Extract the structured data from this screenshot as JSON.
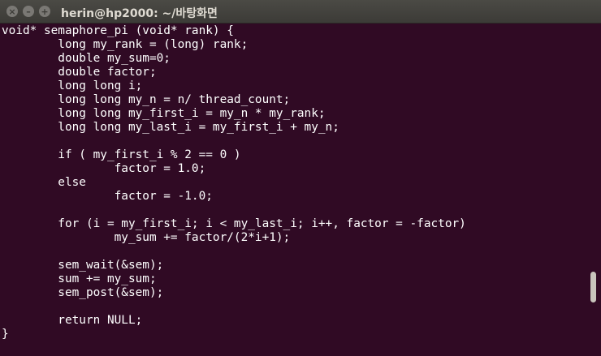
{
  "window": {
    "title": "herin@hp2000: ~/바탕화면",
    "close_glyph": "×",
    "minimize_glyph": "–",
    "maximize_glyph": "+"
  },
  "terminal": {
    "background": "#300a24",
    "foreground": "#ffffff",
    "lines": [
      "void* semaphore_pi (void* rank) {",
      "        long my_rank = (long) rank;",
      "        double my_sum=0;",
      "        double factor;",
      "        long long i;",
      "        long long my_n = n/ thread_count;",
      "        long long my_first_i = my_n * my_rank;",
      "        long long my_last_i = my_first_i + my_n;",
      "",
      "        if ( my_first_i % 2 == 0 )",
      "                factor = 1.0;",
      "        else",
      "                factor = -1.0;",
      "",
      "        for (i = my_first_i; i < my_last_i; i++, factor = -factor)",
      "                my_sum += factor/(2*i+1);",
      "",
      "        sem_wait(&sem);",
      "        sum += my_sum;",
      "        sem_post(&sem);",
      "",
      "        return NULL;",
      "}"
    ]
  }
}
